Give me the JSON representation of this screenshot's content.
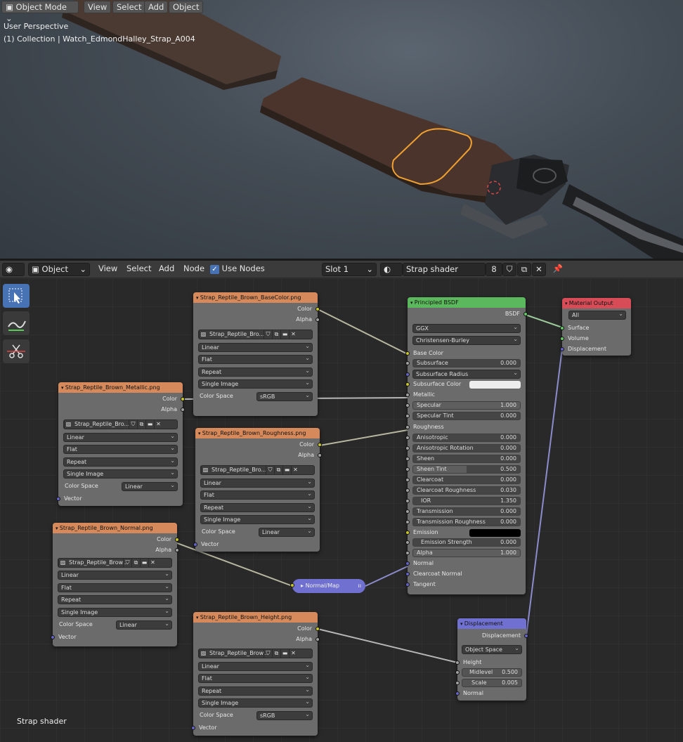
{
  "viewport": {
    "mode": "Object Mode",
    "menu": [
      "View",
      "Select",
      "Add",
      "Object"
    ],
    "perspective": "User Perspective",
    "collection": "(1) Collection | Watch_EdmondHalley_Strap_A004"
  },
  "ne_header": {
    "object": "Object",
    "menu": [
      "View",
      "Select",
      "Add",
      "Node"
    ],
    "use_nodes": "Use Nodes",
    "slot": "Slot 1",
    "material": "Strap shader",
    "users": "8"
  },
  "canvas_label": "Strap shader",
  "img_opts": {
    "interp": "Linear",
    "proj": "Flat",
    "ext": "Repeat",
    "src": "Single Image",
    "cs_label": "Color Space",
    "vector": "Vector",
    "color": "Color",
    "alpha": "Alpha"
  },
  "base": {
    "title": "Strap_Reptile_Brown_BaseColor.png",
    "img": "Strap_Reptile_Bro...",
    "cs": "sRGB"
  },
  "metal": {
    "title": "Strap_Reptile_Brown_Metallic.png",
    "img": "Strap_Reptile_Bro...",
    "cs": "Linear"
  },
  "rough": {
    "title": "Strap_Reptile_Brown_Roughness.png",
    "img": "Strap_Reptile_Bro...",
    "cs": "Linear"
  },
  "normal": {
    "title": "Strap_Reptile_Brown_Normal.png",
    "img": "Strap_Reptile_Brow...",
    "cs": "Linear"
  },
  "height": {
    "title": "Strap_Reptile_Brown_Height.png",
    "img": "Strap_Reptile_Brow...",
    "cs": "sRGB"
  },
  "normal_map": "Normal/Map",
  "bsdf": {
    "title": "Principled BSDF",
    "out": "BSDF",
    "dist": "GGX",
    "sss_method": "Christensen-Burley",
    "base_color": "Base Color",
    "subsurface": {
      "label": "Subsurface",
      "value": "0.000"
    },
    "sss_radius": "Subsurface Radius",
    "sss_color": "Subsurface Color",
    "metallic": "Metallic",
    "specular": {
      "label": "Specular",
      "value": "1.000"
    },
    "spec_tint": {
      "label": "Specular Tint",
      "value": "0.000"
    },
    "roughness": "Roughness",
    "aniso": {
      "label": "Anisotropic",
      "value": "0.000"
    },
    "aniso_rot": {
      "label": "Anisotropic Rotation",
      "value": "0.000"
    },
    "sheen": {
      "label": "Sheen",
      "value": "0.000"
    },
    "sheen_tint": {
      "label": "Sheen Tint",
      "value": "0.500"
    },
    "clearcoat": {
      "label": "Clearcoat",
      "value": "0.000"
    },
    "cc_rough": {
      "label": "Clearcoat Roughness",
      "value": "0.030"
    },
    "ior": {
      "label": "IOR",
      "value": "1.350"
    },
    "trans": {
      "label": "Transmission",
      "value": "0.000"
    },
    "trans_rough": {
      "label": "Transmission Roughness",
      "value": "0.000"
    },
    "emission": "Emission",
    "em_str": {
      "label": "Emission Strength",
      "value": "0.000"
    },
    "alpha": {
      "label": "Alpha",
      "value": "1.000"
    },
    "normal": "Normal",
    "cc_normal": "Clearcoat Normal",
    "tangent": "Tangent"
  },
  "out": {
    "title": "Material Output",
    "target": "All",
    "surface": "Surface",
    "volume": "Volume",
    "disp": "Displacement"
  },
  "disp": {
    "title": "Displacement",
    "out": "Displacement",
    "space": "Object Space",
    "height": "Height",
    "mid": {
      "label": "Midlevel",
      "value": "0.500"
    },
    "scale": {
      "label": "Scale",
      "value": "0.005"
    },
    "normal": "Normal"
  },
  "colors": {
    "image_header": "#d6895a",
    "shader_header": "#5cb85c",
    "output_header": "#d74c57",
    "vector_header": "#7070d0",
    "selection": "#f0a030"
  }
}
